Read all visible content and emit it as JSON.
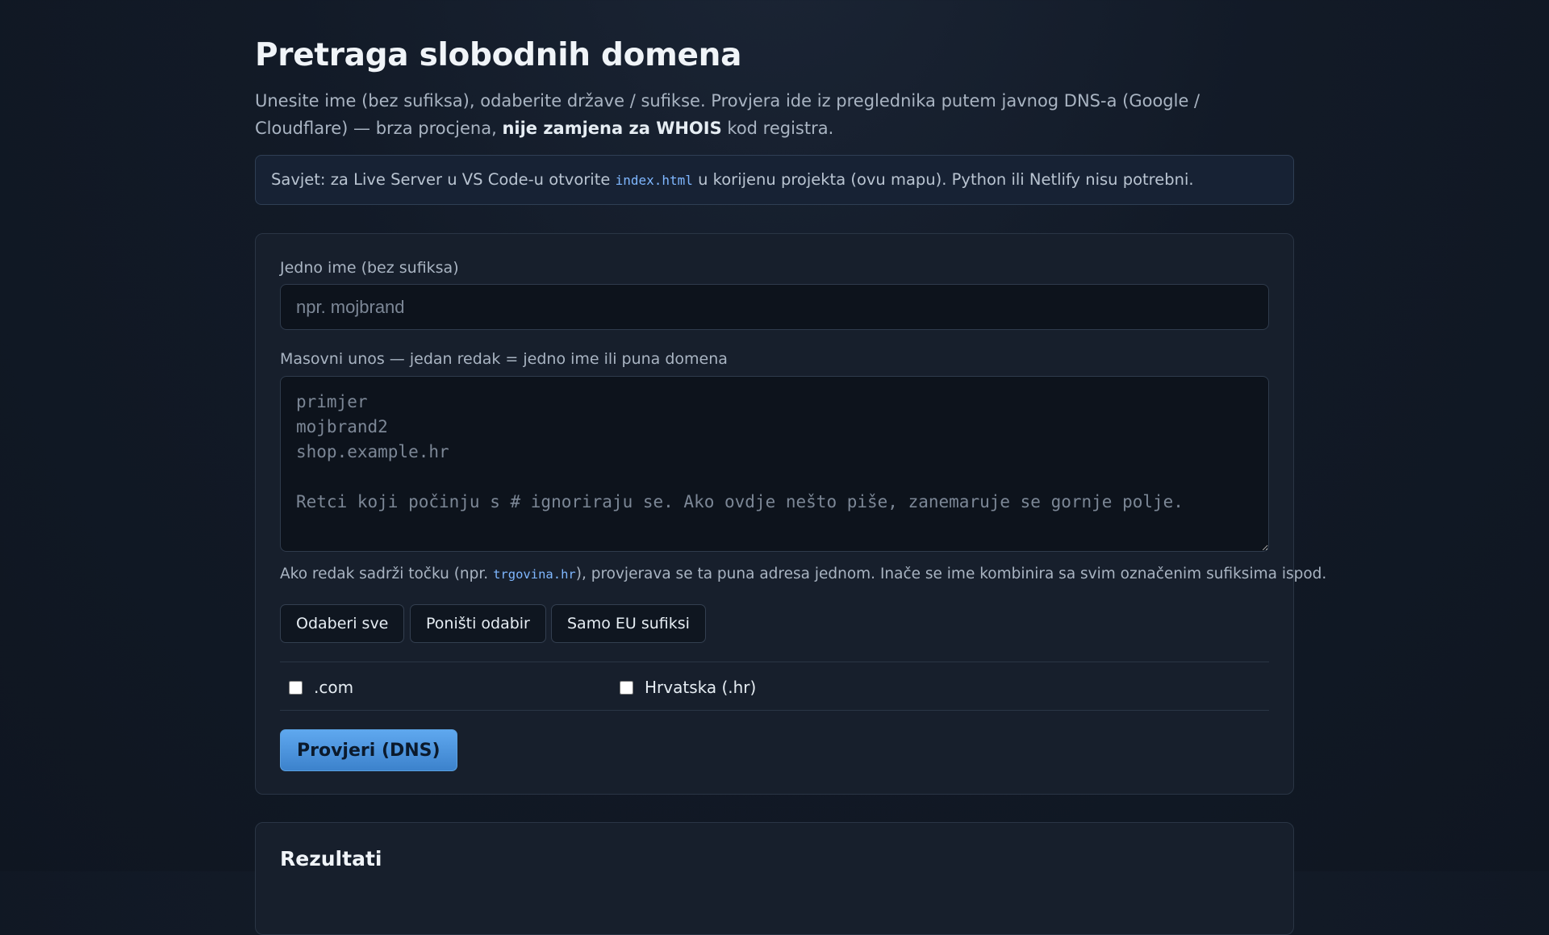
{
  "page": {
    "title": "Pretraga slobodnih domena",
    "lead_part1": "Unesite ime (bez sufiksa), odaberite države / sufikse. Provjera ide iz preglednika putem javnog DNS-a (Google / Cloudflare) — brza procjena, ",
    "lead_strong": "nije zamjena za WHOIS",
    "lead_part2": " kod registra."
  },
  "tip": {
    "text_before": "Savjet: za Live Server u VS Code-u otvorite ",
    "code": "index.html",
    "text_after": " u korijenu projekta (ovu mapu). Python ili Netlify nisu potrebni."
  },
  "form": {
    "single_label": "Jedno ime (bez sufiksa)",
    "single_placeholder": "npr. mojbrand",
    "single_value": "",
    "bulk_label": "Masovni unos — jedan redak = jedno ime ili puna domena",
    "bulk_placeholder": "primjer\nmojbrand2\nshop.example.hr\n\nRetci koji počinju s # ignoriraju se. Ako ovdje nešto piše, zanemaruje se gornje polje.",
    "bulk_value": "",
    "hint_before": "Ako redak sadrži točku (npr. ",
    "hint_code": "trgovina.hr",
    "hint_after": "), provjerava se ta puna adresa jednom. Inače se ime kombinira sa svim označenim sufiksima ispod.",
    "select_all_label": "Odaberi sve",
    "deselect_label": "Poništi odabir",
    "eu_only_label": "Samo EU sufiksi",
    "suffixes": [
      {
        "label": ".com",
        "checked": false
      },
      {
        "label": "Hrvatska (.hr)",
        "checked": false
      }
    ],
    "submit_label": "Provjeri (DNS)"
  },
  "results": {
    "title": "Rezultati"
  }
}
